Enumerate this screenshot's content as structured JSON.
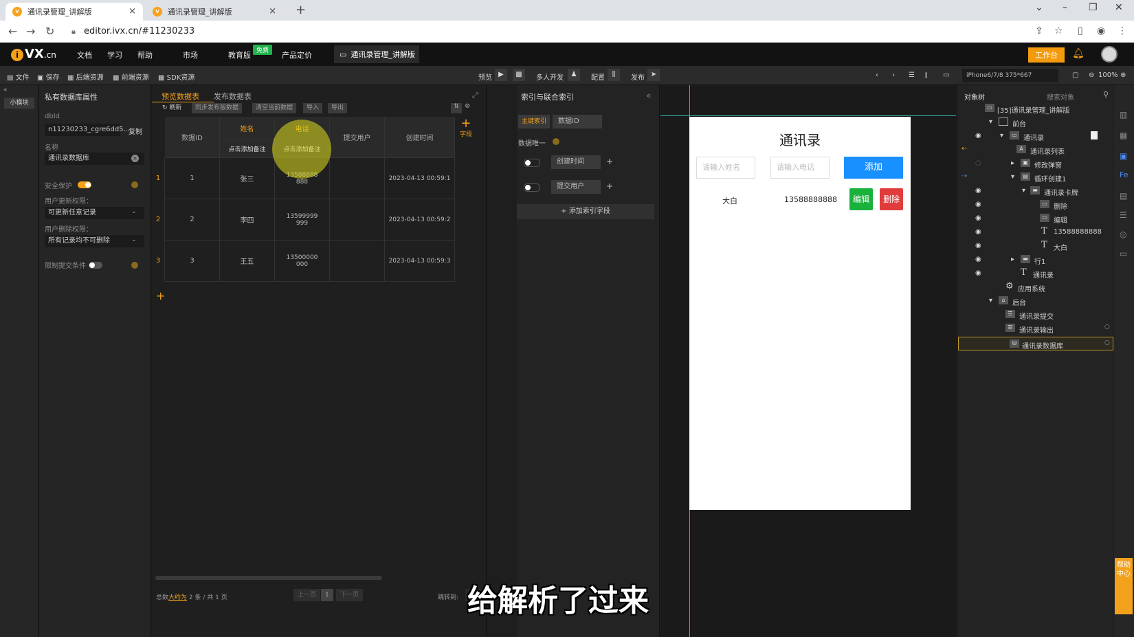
{
  "browser": {
    "tabs": [
      {
        "title": "通讯录管理_讲解版",
        "active": true
      },
      {
        "title": "通讯录管理_讲解版",
        "active": false
      }
    ],
    "url": "editor.ivx.cn/#11230233"
  },
  "topnav": {
    "logo": "VX",
    "logo_suffix": ".cn",
    "menu": [
      "文档",
      "学习",
      "帮助",
      "市场",
      "教育版",
      "产品定价"
    ],
    "free_badge": "免费",
    "project_tab": "通讯录管理_讲解版",
    "workbench": "工作台"
  },
  "toolbar": {
    "left": [
      "文件",
      "保存",
      "后端资源",
      "前端资源",
      "SDK资源"
    ],
    "preview": "预览",
    "multi": "多人开发",
    "config": "配置",
    "publish": "发布",
    "device": "iPhone6/7/8 375*667",
    "zoom": "100%"
  },
  "minibar": {
    "tab": "小模块"
  },
  "props": {
    "title": "私有数据库属性",
    "dbid_label": "dbId",
    "dbid_value": "n11230233_cgre6dd5...",
    "copy": "复制",
    "name_label": "名称",
    "name_value": "通讯录数据库",
    "safe_label": "安全保护",
    "update_label": "用户更新权限：",
    "update_value": "可更新任意记录",
    "delete_label": "用户删除权限：",
    "delete_value": "所有记录均不可删除",
    "limit_label": "限制提交条件"
  },
  "datapanel": {
    "tab_preview": "预览数据表",
    "tab_publish": "发布数据表",
    "refresh": "刷新",
    "sync": "同步发布版数据",
    "clear": "清空当前数据",
    "import": "导入",
    "export": "导出",
    "columns": [
      {
        "title": "数据ID",
        "note": ""
      },
      {
        "title": "姓名",
        "note": "点击添加备注"
      },
      {
        "title": "电话",
        "note": "点击添加备注"
      },
      {
        "title": "提交用户",
        "note": ""
      },
      {
        "title": "创建时间",
        "note": ""
      }
    ],
    "rows": [
      {
        "num": "1",
        "id": "1",
        "name": "张三",
        "phone1": "13588888",
        "phone2": "888",
        "user": "",
        "time": "2023-04-13 00:59:1"
      },
      {
        "num": "2",
        "id": "2",
        "name": "李四",
        "phone1": "13599999",
        "phone2": "999",
        "user": "",
        "time": "2023-04-13 00:59:2"
      },
      {
        "num": "3",
        "id": "3",
        "name": "王五",
        "phone1": "13500000",
        "phone2": "000",
        "user": "",
        "time": "2023-04-13 00:59:3"
      }
    ],
    "add_field": "字段",
    "footer_total_prefix": "总数",
    "footer_total_link": "大约为",
    "footer_total_suffix": "2 条 / 共 1 页",
    "prev": "上一页",
    "page": "1",
    "next": "下一页",
    "jump": "跳转到:"
  },
  "index": {
    "title": "索引与联合索引",
    "primary": "主键索引",
    "primary_field": "数据ID",
    "unique": "数据唯一",
    "field1": "创建时间",
    "field2": "提交用户",
    "add": "添加索引字段"
  },
  "preview": {
    "title": "通讯录",
    "name_placeholder": "请输入姓名",
    "phone_placeholder": "请输入电话",
    "add": "添加",
    "item_name": "大白",
    "item_phone": "13588888888",
    "edit": "编辑",
    "delete": "删除"
  },
  "subtitle": "给解析了过来",
  "tree": {
    "tab": "对象树",
    "search": "搜索对象",
    "items": [
      {
        "label": "[35]通讯录管理_讲解版"
      },
      {
        "label": "前台"
      },
      {
        "label": "通讯录"
      },
      {
        "label": "通讯录列表"
      },
      {
        "label": "修改弹窗"
      },
      {
        "label": "循环创建1"
      },
      {
        "label": "通讯录卡牌"
      },
      {
        "label": "删除"
      },
      {
        "label": "编辑"
      },
      {
        "label": "13588888888"
      },
      {
        "label": "大白"
      },
      {
        "label": "行1"
      },
      {
        "label": "通讯录"
      },
      {
        "label": "应用系统"
      },
      {
        "label": "后台"
      },
      {
        "label": "通讯录提交"
      },
      {
        "label": "通讯录输出"
      },
      {
        "label": "通讯录数据库"
      }
    ]
  },
  "help": "帮助中心"
}
